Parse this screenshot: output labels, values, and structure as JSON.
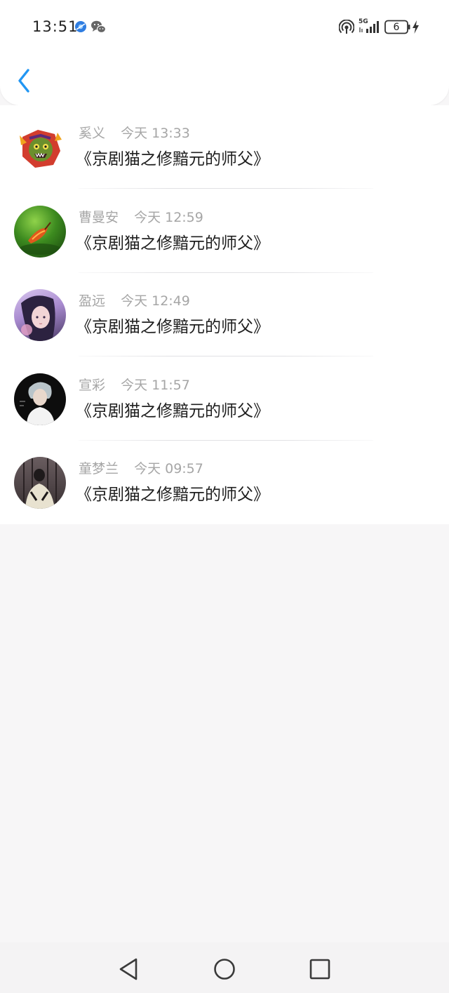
{
  "status_bar": {
    "time": "13:51",
    "network": "5G",
    "battery": "6",
    "icons": [
      "browser-app-icon",
      "wechat-icon",
      "hotspot-icon",
      "signal-icon",
      "battery-icon",
      "charging-icon"
    ]
  },
  "header": {
    "back_icon": "chevron-left-icon",
    "accent_color": "#2196f3"
  },
  "comments": [
    {
      "user": "奚义",
      "time": "今天 13:33",
      "text": "《京剧猫之修黯元的师父》",
      "avatar": "cartoon-monster-avatar"
    },
    {
      "user": "曹曼安",
      "time": "今天 12:59",
      "text": "《京剧猫之修黯元的师父》",
      "avatar": "green-nature-avatar"
    },
    {
      "user": "盈远",
      "time": "今天 12:49",
      "text": "《京剧猫之修黯元的师父》",
      "avatar": "anime-girl-avatar"
    },
    {
      "user": "宣彩",
      "time": "今天 11:57",
      "text": "《京剧猫之修黯元的师父》",
      "avatar": "person-photo-avatar"
    },
    {
      "user": "童梦兰",
      "time": "今天 09:57",
      "text": "《京剧猫之修黯元的师父》",
      "avatar": "dark-photo-avatar"
    }
  ],
  "nav_bar": {
    "buttons": [
      "back-triangle-icon",
      "home-circle-icon",
      "recents-square-icon"
    ]
  }
}
